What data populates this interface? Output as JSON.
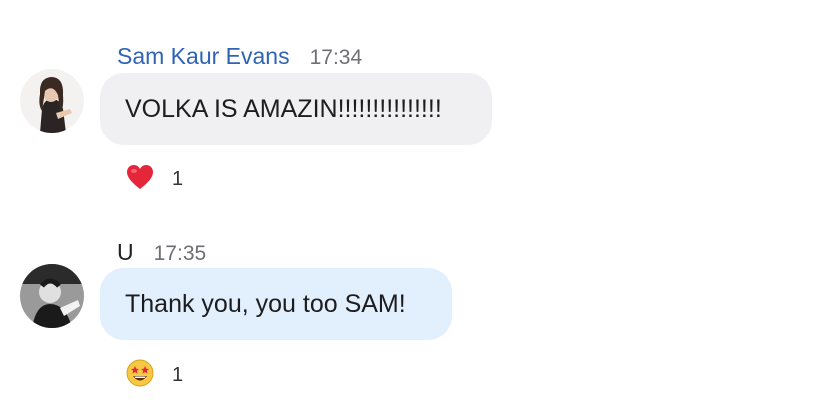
{
  "messages": [
    {
      "sender": "Sam Kaur Evans",
      "time": "17:34",
      "text": "VOLKA IS AMAZIN!!!!!!!!!!!!!!!",
      "reaction": {
        "icon": "red-heart-icon",
        "count": "1"
      }
    },
    {
      "sender": "U",
      "time": "17:35",
      "text": "Thank you, you too SAM!",
      "reaction": {
        "icon": "star-struck-emoji-icon",
        "count": "1"
      }
    }
  ],
  "colors": {
    "sender_link": "#2f63b4",
    "incoming_bubble": "#f0f0f3",
    "outgoing_bubble": "#e2effc"
  }
}
